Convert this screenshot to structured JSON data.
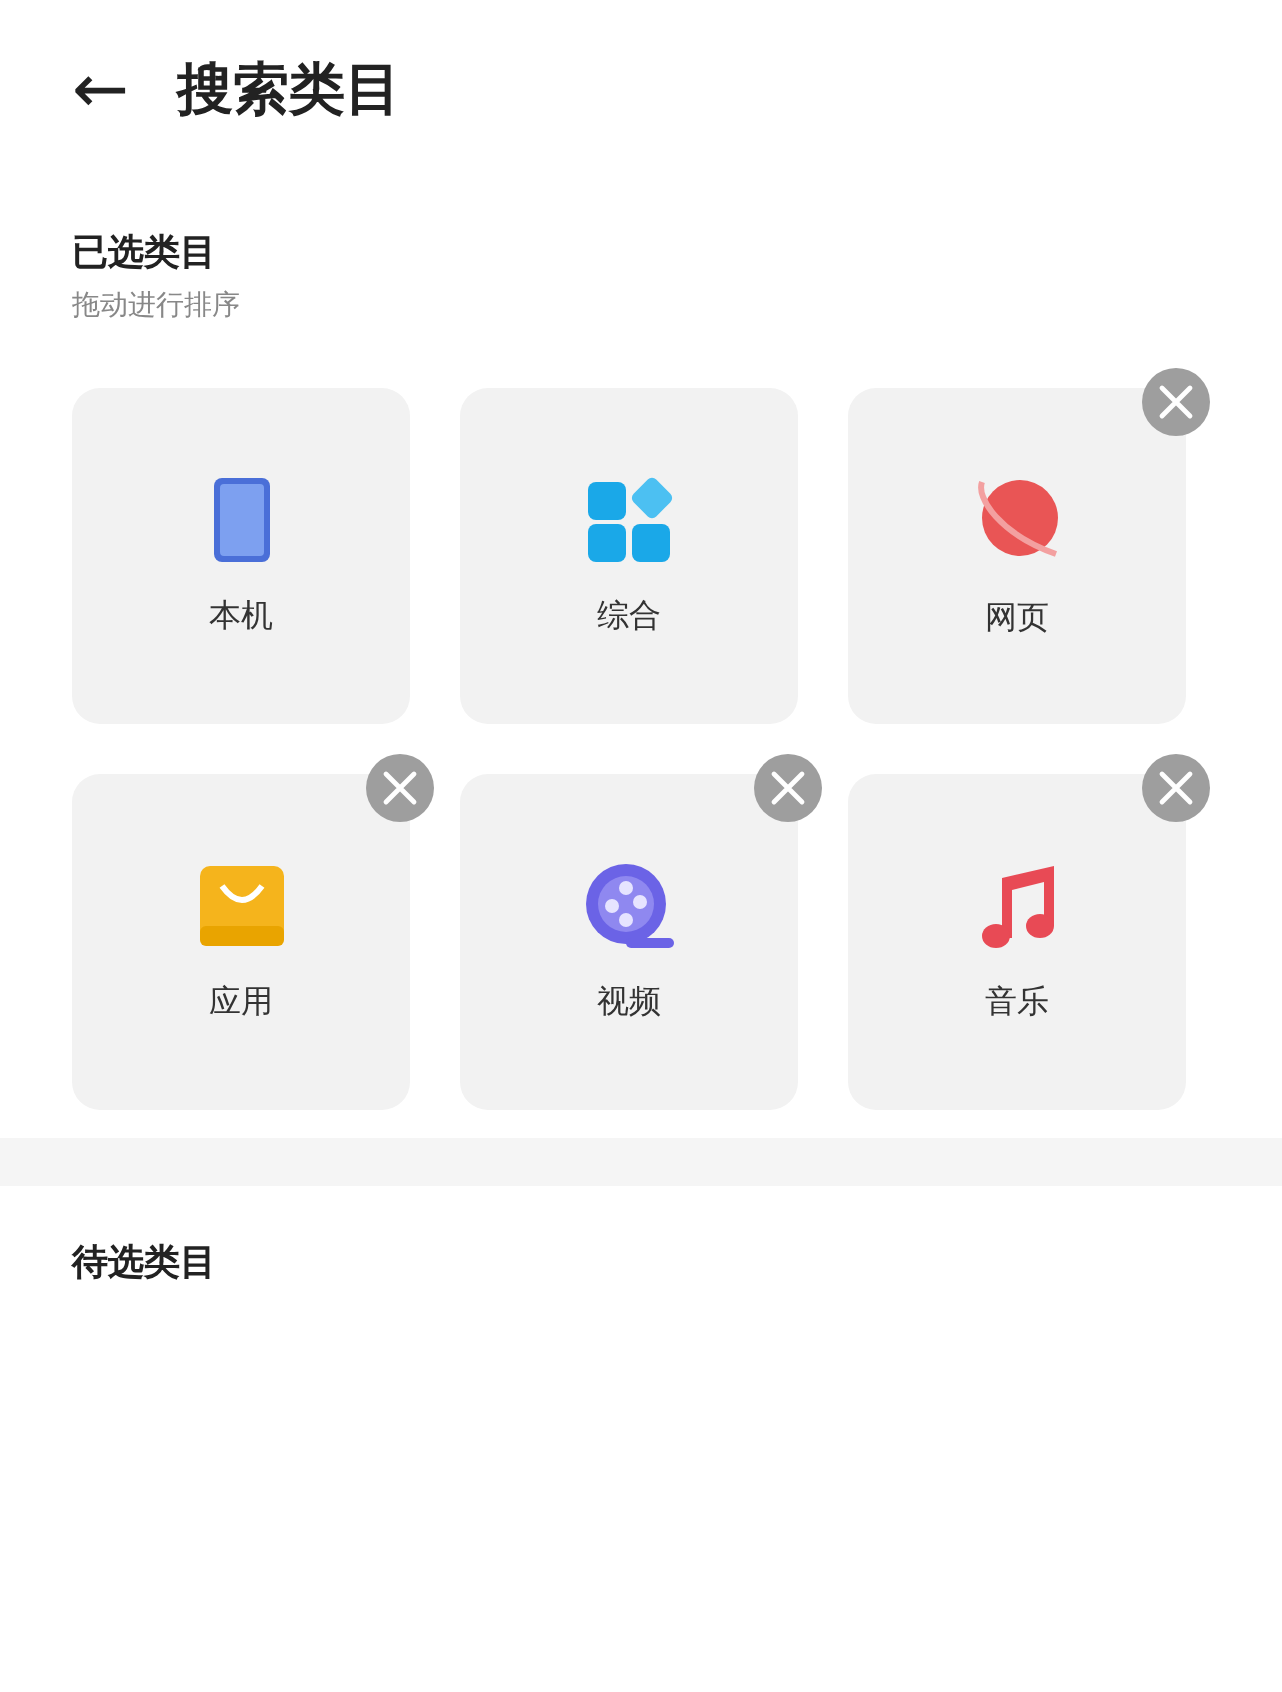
{
  "header": {
    "back": "←",
    "title": "搜索类目"
  },
  "selected_section": {
    "title": "已选类目",
    "subtitle": "拖动进行排序",
    "items": [
      {
        "label": "本机",
        "kind": "phone",
        "removable": false
      },
      {
        "label": "综合",
        "kind": "grid",
        "removable": false
      },
      {
        "label": "网页",
        "kind": "planet",
        "removable": true
      },
      {
        "label": "应用",
        "kind": "bag",
        "removable": true
      },
      {
        "label": "视频",
        "kind": "film",
        "removable": true
      },
      {
        "label": "音乐",
        "kind": "music",
        "removable": true
      }
    ]
  },
  "pending_section": {
    "title": "待选类目"
  }
}
